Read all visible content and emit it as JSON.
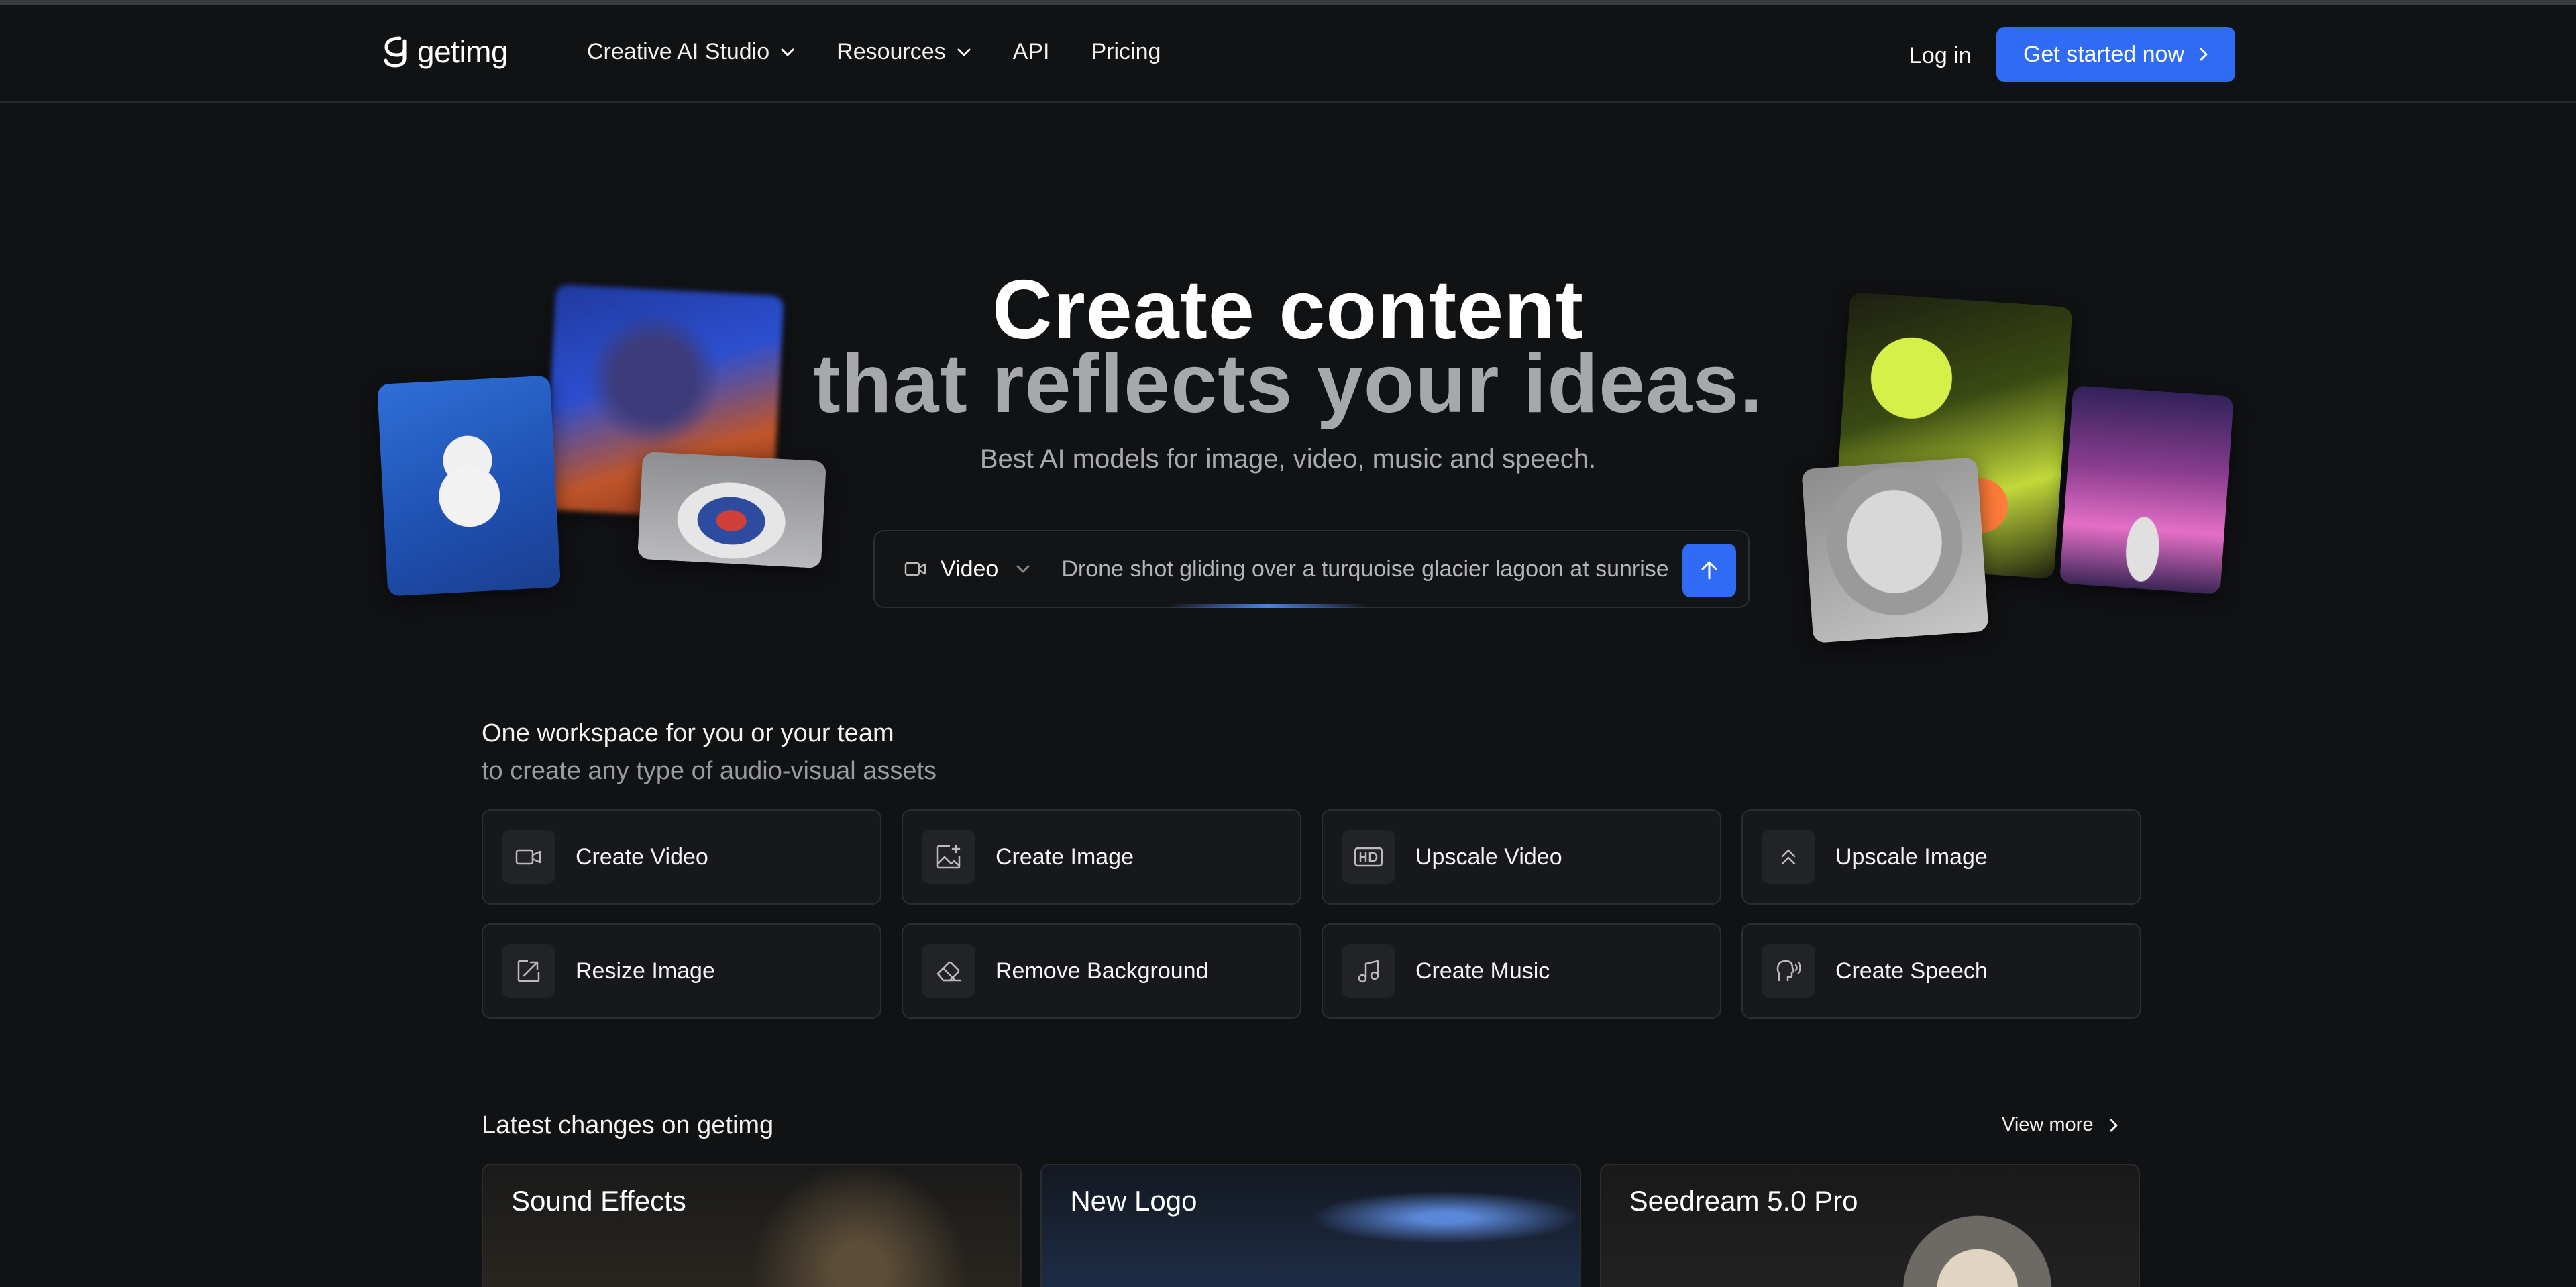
{
  "brand": {
    "name": "getimg"
  },
  "nav": {
    "links": [
      {
        "label": "Creative AI Studio",
        "dropdown": true
      },
      {
        "label": "Resources",
        "dropdown": true
      },
      {
        "label": "API",
        "dropdown": false
      },
      {
        "label": "Pricing",
        "dropdown": false
      }
    ],
    "login_label": "Log in",
    "cta_label": "Get started now"
  },
  "hero": {
    "title_line1": "Create content",
    "title_line2": "that reflects your ideas.",
    "subtitle": "Best AI models for image, video, music and speech.",
    "prompt": {
      "mode_label": "Video",
      "value": "Drone shot gliding over a turquoise glacier lagoon at sunrise"
    }
  },
  "workspace": {
    "heading": "One workspace for you or your team",
    "subheading": "to create any type of audio-visual assets",
    "tools": [
      {
        "label": "Create Video",
        "icon": "video-camera-icon"
      },
      {
        "label": "Create Image",
        "icon": "image-sparkle-icon"
      },
      {
        "label": "Upscale Video",
        "icon": "hd-icon"
      },
      {
        "label": "Upscale Image",
        "icon": "double-chevron-up-icon"
      },
      {
        "label": "Resize Image",
        "icon": "resize-arrow-icon"
      },
      {
        "label": "Remove Background",
        "icon": "eraser-icon"
      },
      {
        "label": "Create Music",
        "icon": "music-note-icon"
      },
      {
        "label": "Create Speech",
        "icon": "speech-head-icon"
      }
    ]
  },
  "latest": {
    "title": "Latest changes on getimg",
    "view_more_label": "View more",
    "items": [
      {
        "label": "Sound Effects"
      },
      {
        "label": "New Logo"
      },
      {
        "label": "Seedream 5.0 Pro"
      }
    ]
  },
  "colors": {
    "background": "#111214",
    "accent": "#2f6bf5",
    "card": "#17181b",
    "border": "#2b2d31"
  }
}
